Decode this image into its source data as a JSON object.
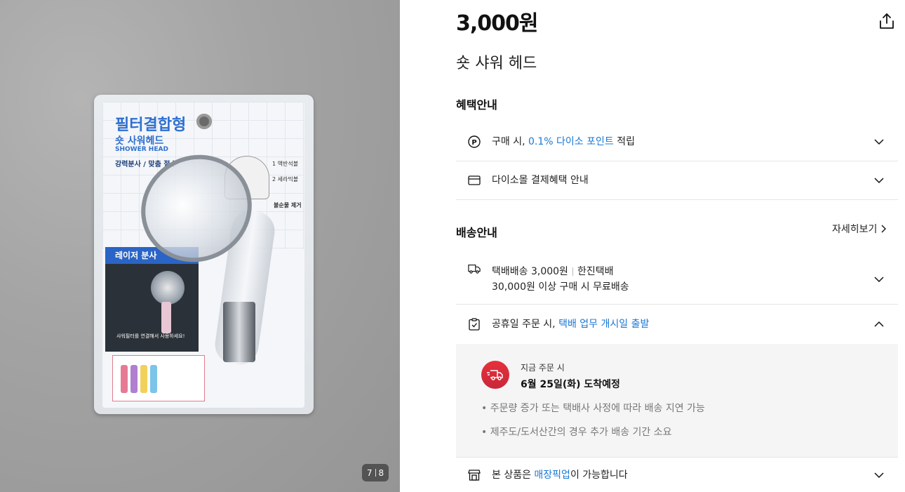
{
  "gallery": {
    "current": "7",
    "total": "8",
    "package_texts": {
      "title": "필터결합형",
      "subtitle": "숏 사워헤드",
      "english": "SHOWER HEAD",
      "feature": "강력분사 / 맞춤 절수",
      "laser": "레이저 분사",
      "connect_note": "샤워필터를 연결해서 사용하세요!",
      "label_a": "1 액반석볼",
      "label_b": "2 세라믹볼",
      "label_c": "불순물 제거"
    }
  },
  "product": {
    "price": "3,000원",
    "name": "숏 샤워 헤드"
  },
  "benefits": {
    "title": "혜택안내",
    "point_prefix": "구매 시, ",
    "point_highlight": "0.1% 다이소 포인트",
    "point_suffix": " 적립",
    "payment": "다이소몰 결제혜택 안내"
  },
  "shipping": {
    "title": "배송안내",
    "more": "자세히보기",
    "line1_a": "택배배송 3,000원",
    "line1_b": "한진택배",
    "line2": "30,000원 이상 구매 시 무료배송",
    "holiday_prefix": "공휴일 주문 시, ",
    "holiday_highlight": "택배 업무 개시일 출발",
    "order_now": "지금 주문 시",
    "arrival": "6월 25일(화) 도착예정",
    "notes": [
      "주문량 증가 또는 택배사 사정에 따라 배송 지연 가능",
      "제주도/도서산간의 경우 추가 배송 기간 소요"
    ],
    "pickup_prefix": "본 상품은 ",
    "pickup_highlight": "매장픽업",
    "pickup_suffix": "이 가능합니다"
  },
  "colors": {
    "accent": "#1a77d6",
    "badge_red": "#e6303b"
  }
}
